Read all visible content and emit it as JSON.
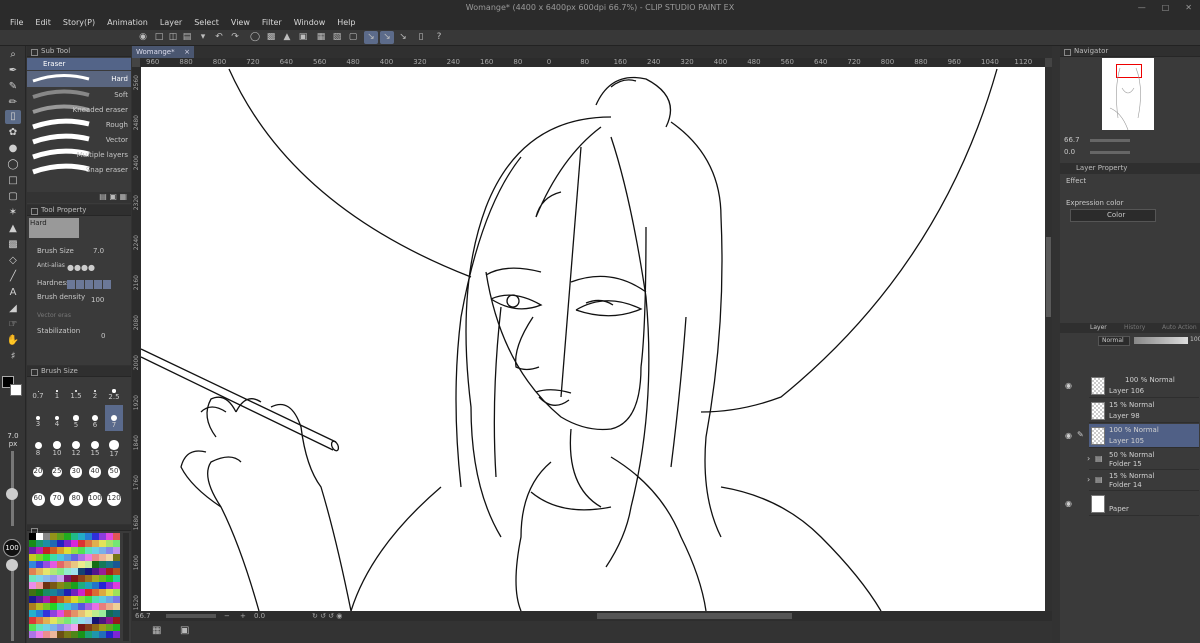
{
  "window": {
    "title": "Womange* (4400 x 6400px 600dpi 66.7%) - CLIP STUDIO PAINT EX"
  },
  "menu": [
    "File",
    "Edit",
    "Story(P)",
    "Animation",
    "Layer",
    "Select",
    "View",
    "Filter",
    "Window",
    "Help"
  ],
  "subtool": {
    "header": "Sub Tool",
    "group": "Eraser",
    "items": [
      "Hard",
      "Soft",
      "Kneaded eraser",
      "Rough",
      "Vector",
      "Multiple layers",
      "Snap eraser"
    ],
    "selected": "Hard"
  },
  "tool_property": {
    "header": "Tool Property",
    "preset": "Hard",
    "brush_size_label": "Brush Size",
    "brush_size_value": "7.0",
    "antialias_label": "Anti-alias",
    "hardness_label": "Hardness",
    "brush_density_label": "Brush density",
    "brush_density_value": "100",
    "vector_label": "Vector eras",
    "stabilization_label": "Stabilization",
    "stabilization_value": "0"
  },
  "brush_size_panel": {
    "header": "Brush Size",
    "sizes": [
      "0.7",
      "1",
      "1.5",
      "2",
      "2.5",
      "3",
      "4",
      "5",
      "6",
      "7",
      "8",
      "10",
      "12",
      "15",
      "17",
      "20",
      "25",
      "30",
      "40",
      "50",
      "60",
      "70",
      "80",
      "100",
      "120"
    ],
    "selected": "7"
  },
  "left_strip": {
    "size_value": "7.0",
    "size_unit": "px",
    "opacity_value": "100"
  },
  "canvas": {
    "tab_label": "Womange*",
    "ruler_top": [
      "960",
      "880",
      "800",
      "720",
      "640",
      "560",
      "480",
      "400",
      "320",
      "240",
      "160",
      "80",
      "0",
      "80",
      "160",
      "240",
      "320",
      "400",
      "480",
      "560",
      "640",
      "720",
      "800",
      "880",
      "960",
      "1040",
      "1120"
    ],
    "ruler_left": [
      "2560",
      "2480",
      "2400",
      "2320",
      "2240",
      "2160",
      "2080",
      "2000",
      "1920",
      "1840",
      "1760",
      "1680",
      "1600",
      "1520"
    ],
    "zoom": "66.7",
    "rotation": "0.0"
  },
  "navigator": {
    "header": "Navigator",
    "zoom": "66.7",
    "angle": "0.0"
  },
  "layer_property": {
    "header": "Layer Property",
    "effect_label": "Effect",
    "expression_label": "Expression color",
    "expression_value": "Color"
  },
  "layer_panel": {
    "tabs": [
      "Layer",
      "History",
      "Auto Action"
    ],
    "blend_mode": "Normal",
    "opacity": "100",
    "layers": [
      {
        "mode": "100 % Normal",
        "name": "Layer 106"
      },
      {
        "mode": "15 % Normal",
        "name": "Layer 98"
      },
      {
        "mode": "100 % Normal",
        "name": "Layer 105"
      },
      {
        "mode": "50 % Normal",
        "name": "Folder 15"
      },
      {
        "mode": "15 % Normal",
        "name": "Folder 14"
      },
      {
        "mode": "",
        "name": "Paper"
      }
    ],
    "selected_index": 2
  },
  "colors": {
    "accent": "#5b6b88",
    "selection": "#506086",
    "panel": "#3a3a3a"
  }
}
